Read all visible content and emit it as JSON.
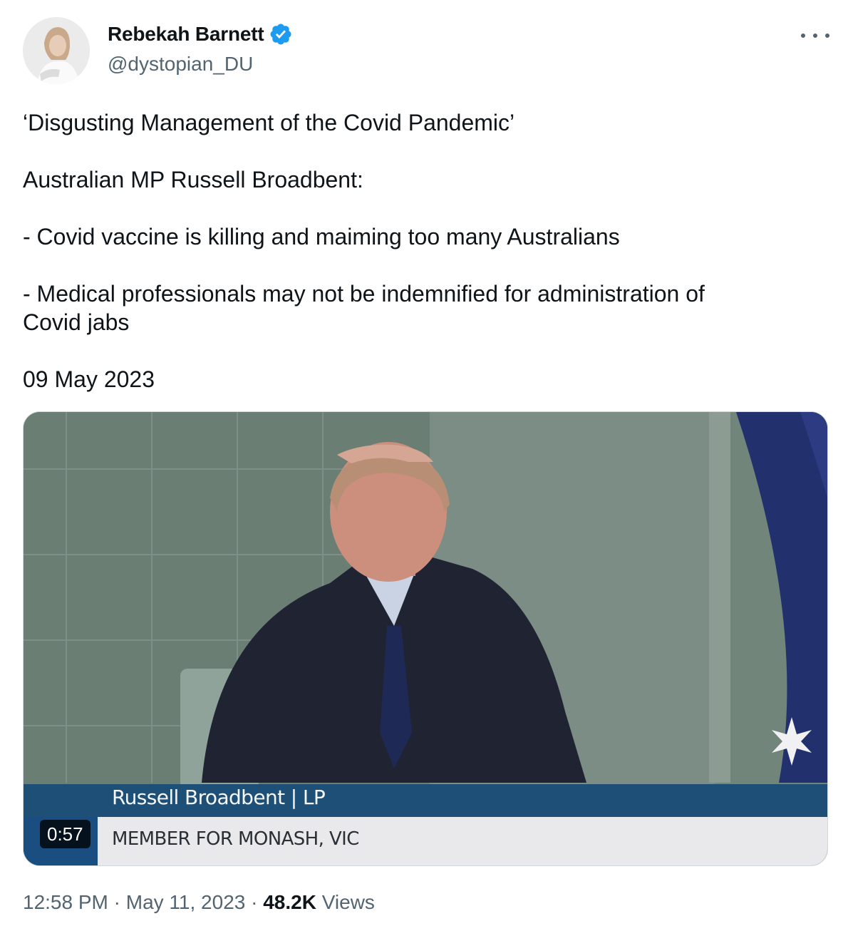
{
  "author": {
    "name": "Rebekah Barnett",
    "handle": "@dystopian_DU",
    "verified_color": "#1d9bf0"
  },
  "tweet": {
    "lines": [
      "‘Disgusting Management of the Covid Pandemic’",
      "Australian MP Russell Broadbent:",
      "- Covid vaccine is killing and maiming too many Australians",
      "- Medical professionals may not be indemnified for administration of",
      "Covid jabs",
      "09 May 2023"
    ]
  },
  "video": {
    "duration": "0:57",
    "lower_third_name": "Russell Broadbent | LP",
    "lower_third_title": "MEMBER FOR MONASH, VIC"
  },
  "meta": {
    "time": "12:58 PM",
    "separator": "·",
    "date": "May 11, 2023",
    "views_count": "48.2K",
    "views_label": "Views"
  },
  "icons": {
    "verified": "verified-badge-icon",
    "more": "more-options-icon",
    "flag_star": "flag-star-icon"
  }
}
